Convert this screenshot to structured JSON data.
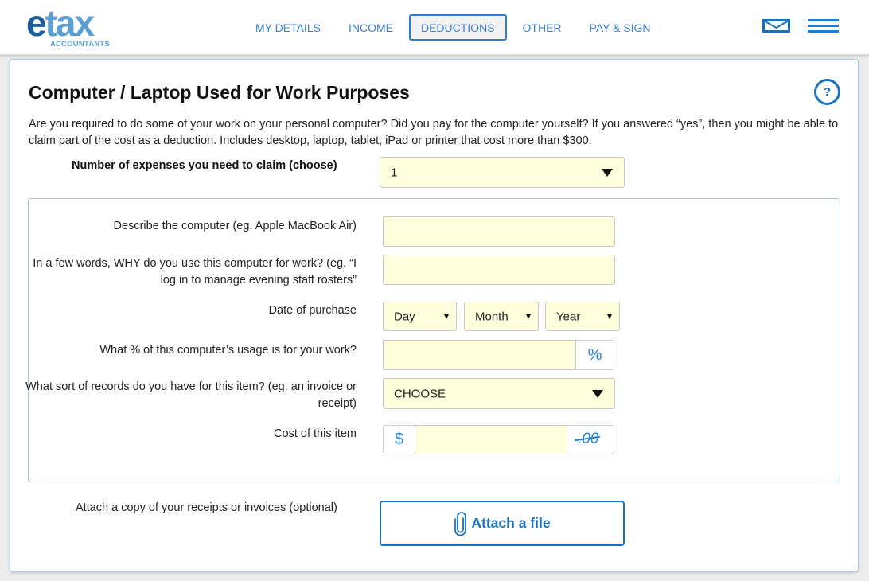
{
  "header": {
    "logo": {
      "word_e": "e",
      "word_tax": "tax",
      "subtitle": "ACCOUNTANTS"
    },
    "nav": [
      {
        "label": "MY DETAILS",
        "active": false
      },
      {
        "label": "INCOME",
        "active": false
      },
      {
        "label": "DEDUCTIONS",
        "active": true
      },
      {
        "label": "OTHER",
        "active": false
      },
      {
        "label": "PAY & SIGN",
        "active": false
      }
    ],
    "icons": {
      "mail": "mail-icon",
      "menu": "hamburger-menu-icon"
    }
  },
  "page": {
    "title": "Computer / Laptop Used for Work Purposes",
    "help_glyph": "?",
    "intro": "Are you required to do some of your work on your personal computer? Did you pay for the computer yourself? If you answered “yes”, then you might be able to claim part of the cost as a deduction. Includes desktop, laptop, tablet, iPad or printer that cost more than $300.",
    "num_expenses": {
      "label": "Number of expenses you need to claim (choose)",
      "value": "1"
    }
  },
  "form": {
    "describe": {
      "label": "Describe the computer (eg. Apple MacBook Air)",
      "value": ""
    },
    "why": {
      "label": "In a few words, WHY do you use this computer for work? (eg. “I log in to manage evening staff rosters”",
      "value": ""
    },
    "date": {
      "label": "Date of purchase",
      "day": "Day",
      "month": "Month",
      "year": "Year"
    },
    "usage": {
      "label": "What % of this computer’s usage is for your work?",
      "value": "",
      "suffix": "%"
    },
    "records": {
      "label": "What sort of records do you have for this item? (eg. an invoice or receipt)",
      "value": "CHOOSE"
    },
    "cost": {
      "label": "Cost of this item",
      "prefix": "$",
      "value": "",
      "suffix": ".00"
    }
  },
  "attach": {
    "label": "Attach a copy of your receipts or invoices (optional)",
    "button": "Attach a file"
  },
  "colors": {
    "accent": "#1a72c2",
    "nav_text": "#3a7fd0",
    "field_bg": "#ffffdd",
    "card_border": "#a9c7e6"
  }
}
